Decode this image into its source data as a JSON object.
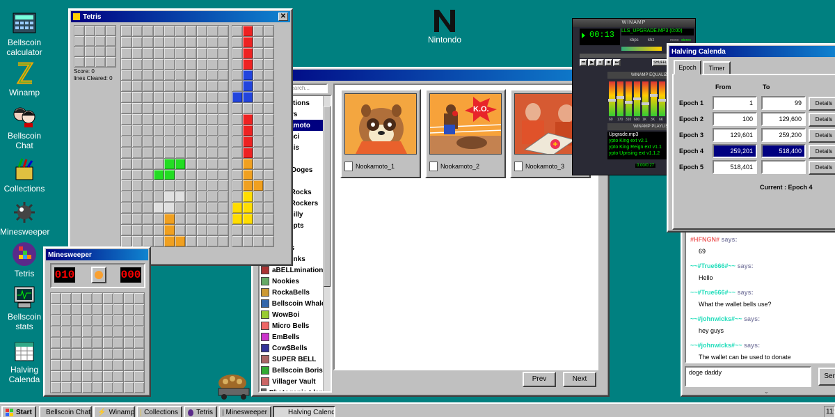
{
  "desktop": {
    "icons": [
      {
        "label": "Bellscoin calculator",
        "icon": "calculator-icon"
      },
      {
        "label": "Winamp",
        "icon": "winamp-icon"
      },
      {
        "label": "Bellscoin Chat",
        "icon": "chat-icon"
      },
      {
        "label": "Collections",
        "icon": "collections-icon"
      },
      {
        "label": "Minesweeper",
        "icon": "mine-icon"
      },
      {
        "label": "Tetris",
        "icon": "tetris-icon"
      },
      {
        "label": "Bellscoin stats",
        "icon": "stats-icon"
      },
      {
        "label": "Halving Calenda",
        "icon": "calendar-icon"
      }
    ],
    "brand": "Nintondo"
  },
  "tetris": {
    "title": "Tetris",
    "score": "Score: 0",
    "lines": "lines Cleared: 0"
  },
  "minesweeper": {
    "title": "Minesweeper",
    "mines": "010",
    "time": "000"
  },
  "collections": {
    "search_placeholder": "Search...",
    "list": [
      "Collections",
      "Avatars",
      "Nookamoto",
      "Da Vinci",
      "Genesis",
      "Bells",
      "Doge Doges",
      "Punks",
      "Bells Rocks",
      "Bells Rockers",
      "Silly Billy",
      "Concepts",
      "Punks",
      "Micros",
      "Bellpunks",
      "aBELLminations",
      "Nookies",
      "RockaBells",
      "Bellscoin Whales",
      "WowBoi",
      "Micro Bells",
      "EmBells",
      "Cow$Bells",
      "SUPER BELL",
      "Bellscoin Boris",
      "Villager Vault",
      "Photogenic Llama"
    ],
    "selected": "Nookamoto",
    "cards": [
      {
        "name": "Nookamoto_1"
      },
      {
        "name": "Nookamoto_2",
        "badge": "K.O."
      },
      {
        "name": "Nookamoto_3"
      }
    ],
    "prev": "Prev",
    "next": "Next"
  },
  "winamp": {
    "title": "WINAMP",
    "time": "00:13",
    "track": "LLS_UPGRADE.MP3 (0:00)",
    "kbps": "kbps",
    "khz": "khz",
    "mono": "mono",
    "stereo": "stereo",
    "shuffle": "SHUFFLE",
    "eq_title": "WINAMP EQUALIZER",
    "pl_title": "WINAMP PLAYLIST",
    "playlist": [
      "Upgrade.mp3",
      "ypto King ext v2.1",
      "ypto King Reign ext v1.1",
      "ypto Uprising ext v1.1.2"
    ],
    "pl_time": "0:00/0:27",
    "eq_labels": [
      "60",
      "170",
      "310",
      "600",
      "1K",
      "3K",
      "6K",
      "12K",
      "14K",
      "16K"
    ]
  },
  "halving": {
    "title": "Halving Calenda",
    "tabs": [
      "Epoch",
      "Timer"
    ],
    "col_from": "From",
    "col_to": "To",
    "rows": [
      {
        "label": "Epoch 1",
        "from": "1",
        "to": "99",
        "details": "Details"
      },
      {
        "label": "Epoch 2",
        "from": "100",
        "to": "129,600",
        "details": "Details"
      },
      {
        "label": "Epoch 3",
        "from": "129,601",
        "to": "259,200",
        "details": "Details"
      },
      {
        "label": "Epoch 4",
        "from": "259,201",
        "to": "518,400",
        "details": "Details"
      },
      {
        "label": "Epoch 5",
        "from": "518,401",
        "to": "",
        "details": "Details"
      }
    ],
    "current": "Current : Epoch 4"
  },
  "chat": {
    "messages": [
      {
        "who": "#HFNGN#",
        "says": "says:",
        "text": "69"
      },
      {
        "who": "~~#True666#~~",
        "says": "says:",
        "text": "Hello"
      },
      {
        "who": "~~#True666#~~",
        "says": "says:",
        "text": "What the wallet bells use?"
      },
      {
        "who": "~~#johnwicks#~~",
        "says": "says:",
        "text": "hey guys"
      },
      {
        "who": "~~#johnwicks#~~",
        "says": "says:",
        "text": "The wallet can be used to donate"
      }
    ],
    "input": "doge daddy",
    "send": "Send"
  },
  "taskbar": {
    "start": "Start",
    "tasks": [
      {
        "label": "Bellscoin Chat"
      },
      {
        "label": "Winamp"
      },
      {
        "label": "Collections"
      },
      {
        "label": "Tetris"
      },
      {
        "label": "Minesweeper"
      },
      {
        "label": "Halving Calenda"
      }
    ],
    "clock": "11:"
  }
}
